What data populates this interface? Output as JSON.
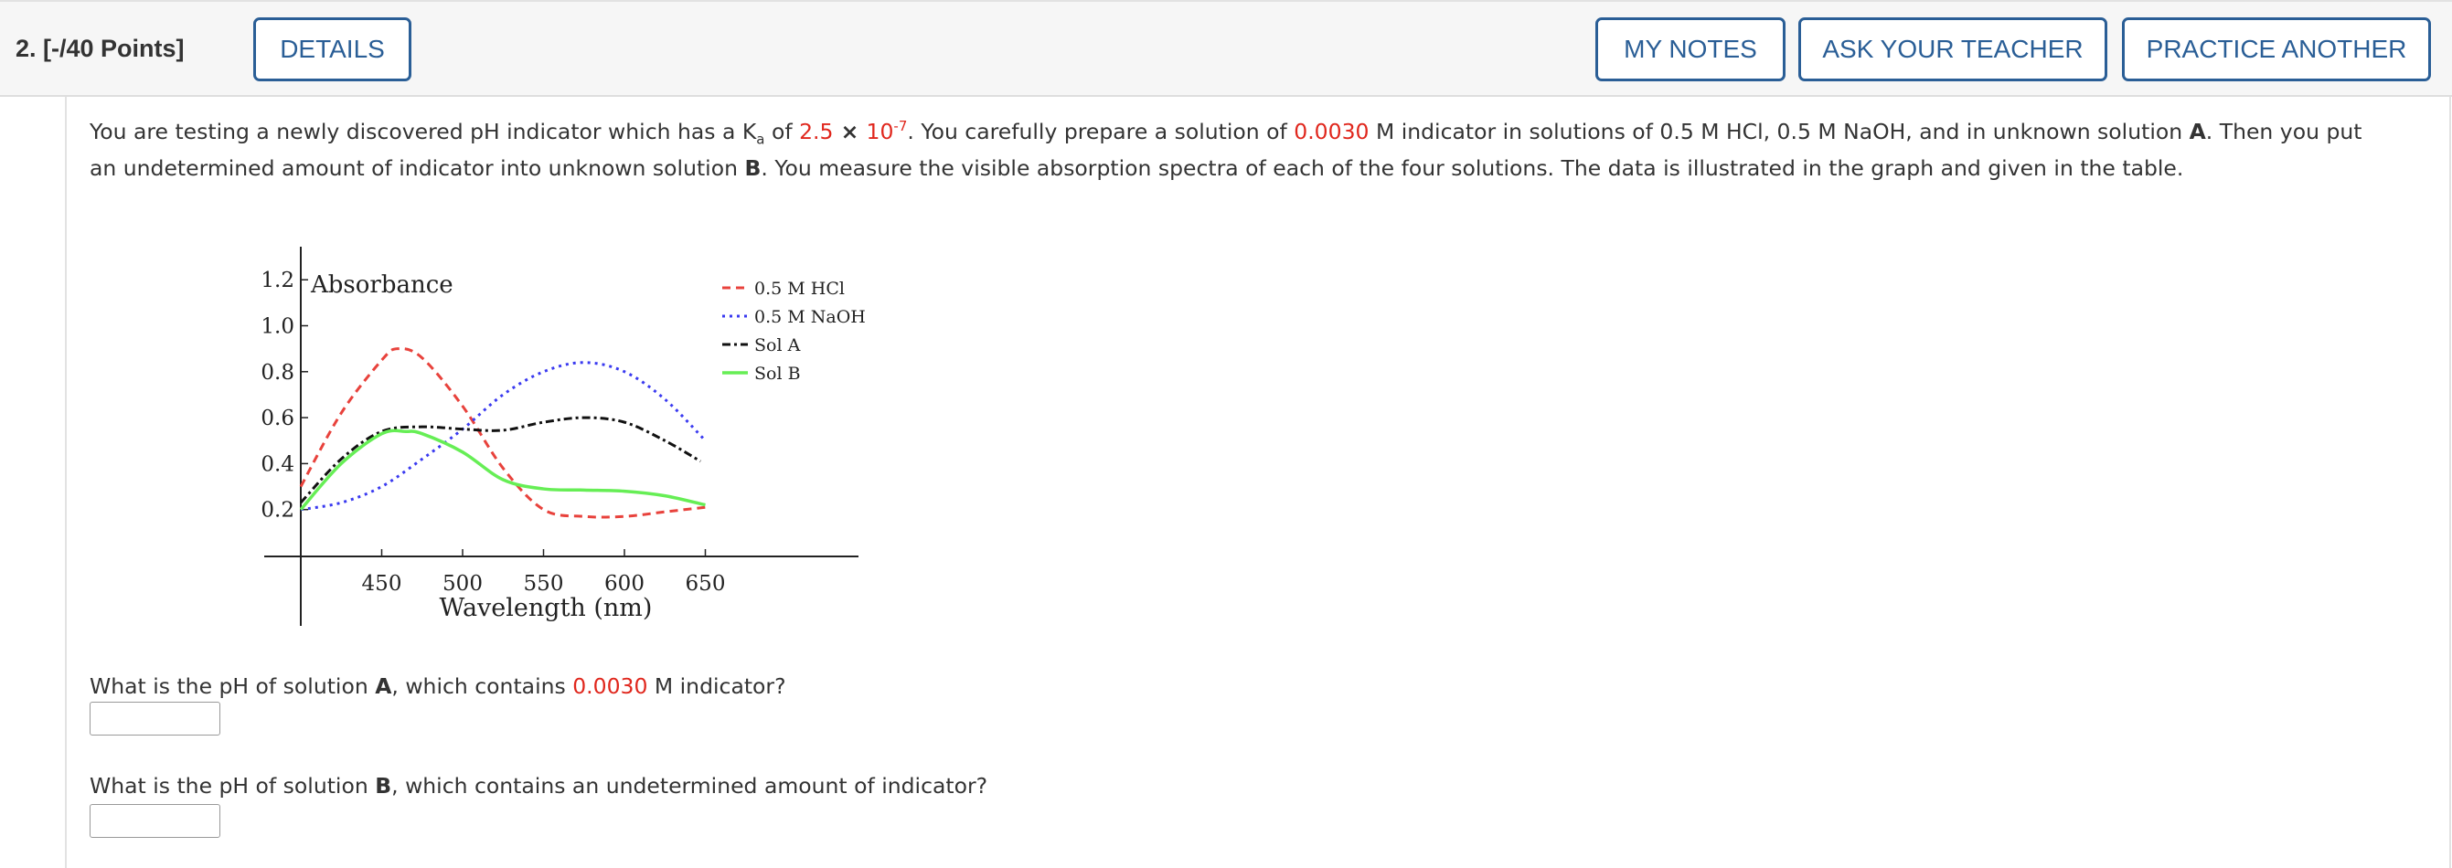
{
  "header": {
    "question_number": "2. [-/40 Points]",
    "buttons": {
      "details": "DETAILS",
      "my_notes": "MY NOTES",
      "ask_teacher": "ASK YOUR TEACHER",
      "practice_another": "PRACTICE ANOTHER"
    },
    "button_color": "#2a5e96"
  },
  "problem": {
    "line1": {
      "t1": "You are testing a newly discovered pH indicator which has a K",
      "ka_sub": "a",
      "t2": " of ",
      "ka_mantissa": "2.5",
      "t3": " × ",
      "ka_base": "10",
      "ka_exp": "-7",
      "t4": ". You carefully prepare a solution of ",
      "concentration": "0.0030",
      "t5": " M indicator in solutions of 0.5 M HCl, 0.5 M NaOH, and in unknown solution ",
      "sol_a": "A",
      "t6": ". Then you put"
    },
    "line2": {
      "t1": "an undetermined amount of indicator into unknown solution ",
      "sol_b": "B",
      "t2": ". You measure the visible absorption spectra of each of the four solutions. The data is illustrated in the graph and given in the table."
    },
    "highlight_color": "#e0271d"
  },
  "questions": [
    {
      "t1": "What is the pH of solution ",
      "bold": "A",
      "t2": ", which contains ",
      "red": "0.0030",
      "t3": " M indicator?",
      "answer": ""
    },
    {
      "t1": "What is the pH of solution ",
      "bold": "B",
      "t2": ", which contains an undetermined amount of indicator?",
      "answer": ""
    }
  ],
  "chart_data": {
    "type": "line",
    "ylabel": "Absorbance",
    "xlabel": "Wavelength (nm)",
    "xlim": [
      400,
      680
    ],
    "ylim": [
      0,
      1.3
    ],
    "x_ticks": [
      450,
      500,
      550,
      600,
      650
    ],
    "y_ticks": [
      "0.2",
      "0.4",
      "0.6",
      "0.8",
      "1.0",
      "1.2"
    ],
    "grid": false,
    "legend_placement": "top-right",
    "series": [
      {
        "name": "0.5 M HCl",
        "color": "#e8423c",
        "style": "dashed",
        "x": [
          400,
          425,
          450,
          460,
          475,
          500,
          525,
          550,
          575,
          600,
          625,
          650
        ],
        "y": [
          0.3,
          0.62,
          0.85,
          0.9,
          0.86,
          0.65,
          0.38,
          0.2,
          0.17,
          0.17,
          0.19,
          0.21
        ]
      },
      {
        "name": "0.5 M NaOH",
        "color": "#3a3af0",
        "style": "dotted",
        "x": [
          400,
          425,
          450,
          475,
          500,
          525,
          550,
          575,
          600,
          625,
          650
        ],
        "y": [
          0.2,
          0.23,
          0.3,
          0.42,
          0.55,
          0.7,
          0.8,
          0.84,
          0.8,
          0.68,
          0.5
        ]
      },
      {
        "name": "Sol A",
        "color": "#111111",
        "style": "dashdot",
        "x": [
          400,
          425,
          450,
          475,
          500,
          525,
          550,
          575,
          600,
          625,
          647
        ],
        "y": [
          0.23,
          0.42,
          0.54,
          0.56,
          0.55,
          0.545,
          0.58,
          0.6,
          0.58,
          0.5,
          0.41
        ]
      },
      {
        "name": "Sol B",
        "color": "#66ee55",
        "style": "solid",
        "x": [
          400,
          425,
          450,
          465,
          475,
          500,
          525,
          550,
          575,
          600,
          625,
          650
        ],
        "y": [
          0.2,
          0.4,
          0.53,
          0.54,
          0.53,
          0.45,
          0.33,
          0.29,
          0.285,
          0.28,
          0.26,
          0.22
        ]
      }
    ]
  }
}
